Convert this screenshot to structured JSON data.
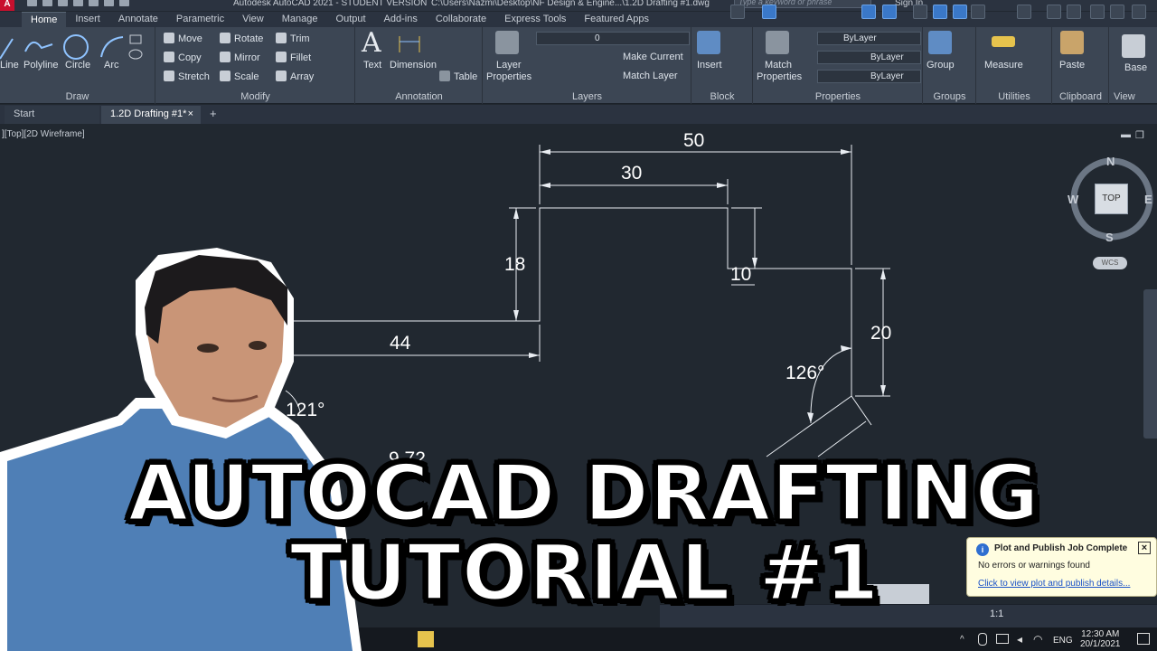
{
  "titlebar": {
    "app_title": "Autodesk AutoCAD 2021 - STUDENT VERSION",
    "file_path": "C:\\Users\\Nazmi\\Desktop\\NF Design & Engine...\\1.2D Drafting #1.dwg",
    "search_placeholder": "Type a keyword or phrase",
    "sign_in": "Sign In"
  },
  "ribbon_tabs": [
    "Home",
    "Insert",
    "Annotate",
    "Parametric",
    "View",
    "Manage",
    "Output",
    "Add-ins",
    "Collaborate",
    "Express Tools",
    "Featured Apps"
  ],
  "ribbon": {
    "draw": {
      "title": "Draw",
      "line": "Line",
      "polyline": "Polyline",
      "circle": "Circle",
      "arc": "Arc"
    },
    "modify": {
      "title": "Modify",
      "move": "Move",
      "rotate": "Rotate",
      "trim": "Trim",
      "copy": "Copy",
      "mirror": "Mirror",
      "fillet": "Fillet",
      "stretch": "Stretch",
      "scale": "Scale",
      "array": "Array"
    },
    "annotation": {
      "title": "Annotation",
      "text": "Text",
      "dimension": "Dimension",
      "table": "Table"
    },
    "layers": {
      "title": "Layers",
      "layer_properties_1": "Layer",
      "layer_properties_2": "Properties",
      "current_layer": "0",
      "make_current": "Make Current",
      "match_layer": "Match Layer"
    },
    "block": {
      "title": "Block",
      "insert": "Insert"
    },
    "properties": {
      "title": "Properties",
      "match_1": "Match",
      "match_2": "Properties",
      "bylayer_color": "ByLayer",
      "bylayer_linetype": "ByLayer",
      "bylayer_lineweight": "ByLayer"
    },
    "groups": {
      "title": "Groups",
      "group": "Group"
    },
    "utilities": {
      "title": "Utilities",
      "measure": "Measure"
    },
    "clipboard": {
      "title": "Clipboard",
      "paste": "Paste"
    },
    "view": {
      "title": "View",
      "base": "Base"
    }
  },
  "file_tabs": {
    "start": "Start",
    "active": "1.2D Drafting #1*",
    "close": "×",
    "new": "+"
  },
  "viewport_label": "][Top][2D Wireframe]",
  "viewcube": {
    "north": "N",
    "south": "S",
    "west": "W",
    "east": "E",
    "top": "TOP",
    "wcs": "WCS"
  },
  "dimensions": {
    "d50": "50",
    "d30": "30",
    "d18": "18",
    "d10": "10",
    "d20": "20",
    "d44": "44",
    "a126": "126°",
    "a121": "121°",
    "partial": "9.72"
  },
  "notification": {
    "title": "Plot and Publish Job Complete",
    "body": "No errors or warnings found",
    "link": "Click to view plot and publish details...",
    "close": "×"
  },
  "statusbar": {
    "scale": "1:1"
  },
  "taskbar": {
    "lang": "ENG",
    "time": "12:30 AM",
    "date": "20/1/2021"
  },
  "thumbnail": {
    "line1": "AUTOCAD DRAFTING",
    "line2": "TUTORIAL #1"
  },
  "colors": {
    "canvas": "#212830",
    "ribbon": "#3c4654",
    "accent": "#3a78c8"
  }
}
